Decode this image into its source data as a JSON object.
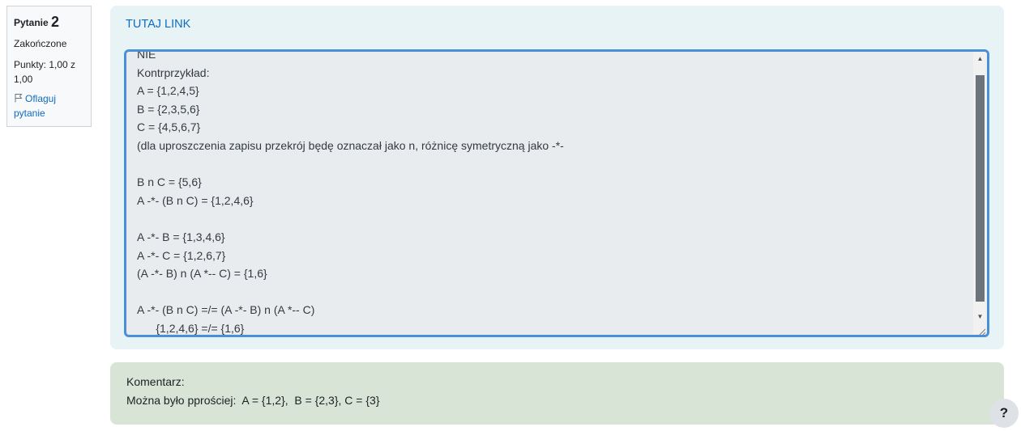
{
  "question_info": {
    "label": "Pytanie",
    "number": "2",
    "state": "Zakończone",
    "grade": "Punkty: 1,00 z 1,00",
    "flag_label": "Oflaguj pytanie",
    "flag_icon": "flag-icon"
  },
  "formulation": {
    "link_text": "TUTAJ LINK",
    "answer_text": "NIE\nKontrprzykład:\nA = {1,2,4,5}\nB = {2,3,5,6}\nC = {4,5,6,7}\n(dla uproszczenia zapisu przekrój będę oznaczał jako n, różnicę symetryczną jako -*-\n\nB n C = {5,6}\nA -*- (B n C) = {1,2,4,6}\n\nA -*- B = {1,3,4,6}\nA -*- C = {1,2,6,7}\n(A -*- B) n (A *-- C) = {1,6}\n\nA -*- (B n C) =/= (A -*- B) n (A *-- C)\n      {1,2,4,6} =/= {1,6}"
  },
  "feedback": {
    "title": "Komentarz:",
    "text": "Można było pprościej:  A = {1,2},  B = {2,3}, C = {3}"
  },
  "help": {
    "label": "?"
  },
  "colors": {
    "accent": "#0f6cbf",
    "focus_border": "#4a90d9",
    "formulation_bg": "#e7f3f5",
    "feedback_bg": "#d8e4d6",
    "answer_bg": "#e9ecef"
  }
}
